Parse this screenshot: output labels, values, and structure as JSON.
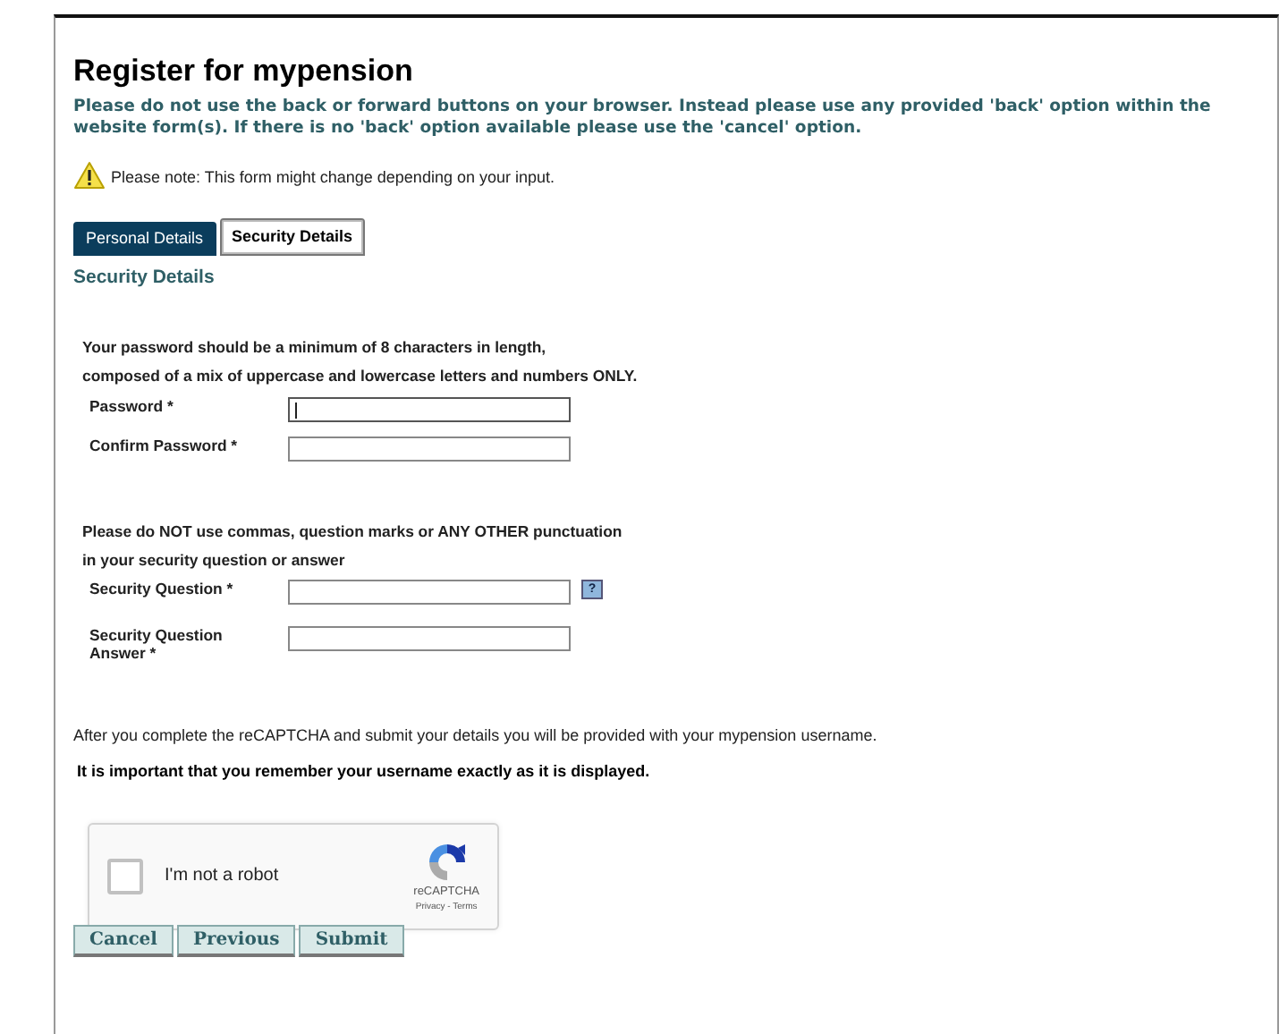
{
  "title": "Register for mypension",
  "warning": "Please do not use the back or forward buttons on your browser. Instead please use any provided 'back' option within the website form(s). If there is no 'back' option available please use the 'cancel' option.",
  "note": "Please note: This form might change depending on your input.",
  "tabs": [
    {
      "label": "Personal Details",
      "selected": false
    },
    {
      "label": "Security Details",
      "selected": true
    }
  ],
  "section_title": "Security Details",
  "groups": [
    {
      "intro": [
        "Your password should be a minimum of 8 characters in length,",
        "composed of a mix of uppercase and lowercase letters and numbers ONLY."
      ],
      "fields": [
        {
          "label": "Password *",
          "help": false,
          "focused": true
        },
        {
          "label": "Confirm Password *",
          "help": false,
          "focused": false
        }
      ]
    },
    {
      "intro": [
        "Please do NOT use commas, question marks or ANY OTHER punctuation",
        "in your security question or answer"
      ],
      "fields": [
        {
          "label": "Security Question *",
          "help": true,
          "help_text": "?",
          "focused": false
        },
        {
          "label": "Security Question Answer *",
          "help": false,
          "focused": false
        }
      ]
    }
  ],
  "info": "After you complete the reCAPTCHA and submit your details you will be provided with your mypension username.",
  "important": "It is important that you remember your username exactly as it is displayed.",
  "captcha": {
    "label": "I'm not a robot",
    "checked": false,
    "brand": "reCAPTCHA",
    "links": "Privacy - Terms"
  },
  "buttons": [
    "Cancel",
    "Previous",
    "Submit"
  ]
}
